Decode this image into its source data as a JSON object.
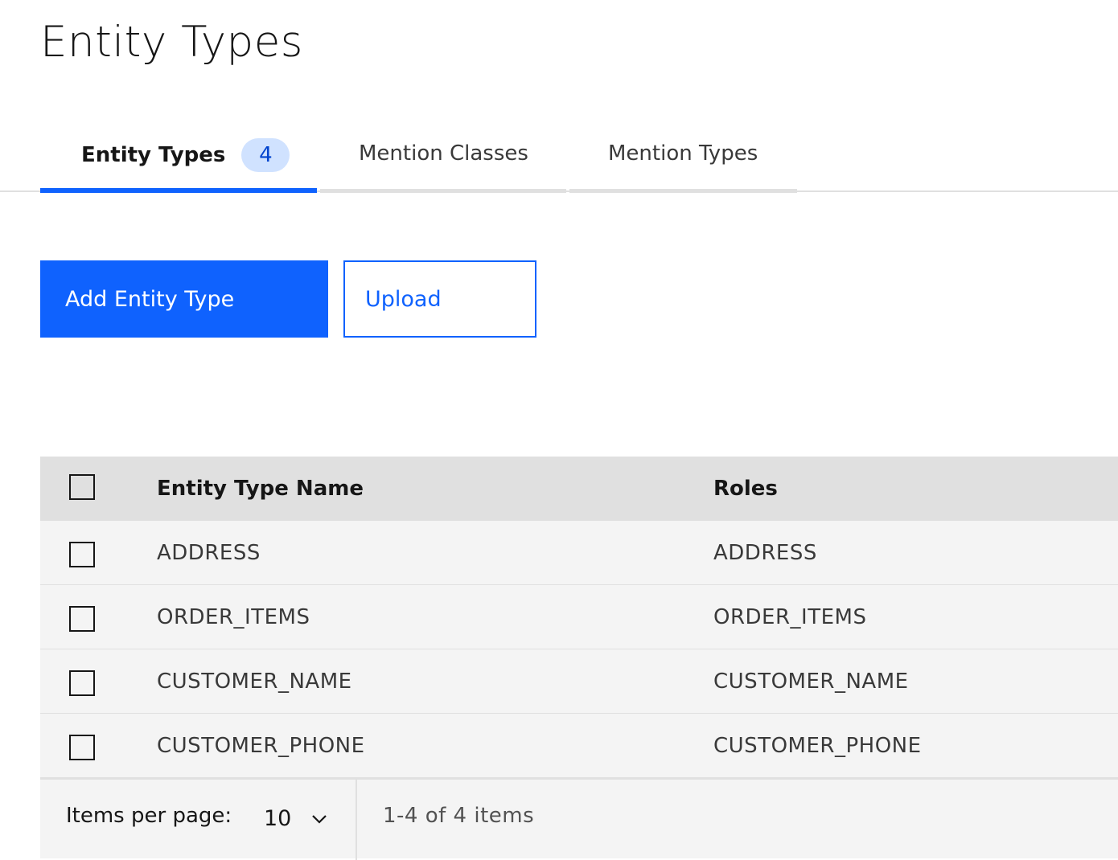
{
  "page": {
    "title": "Entity Types"
  },
  "tabs": [
    {
      "label": "Entity Types",
      "badge": "4",
      "active": true
    },
    {
      "label": "Mention Classes",
      "active": false
    },
    {
      "label": "Mention Types",
      "active": false
    }
  ],
  "actions": {
    "add_label": "Add Entity Type",
    "upload_label": "Upload"
  },
  "table": {
    "columns": [
      "Entity Type Name",
      "Roles"
    ],
    "rows": [
      {
        "name": "ADDRESS",
        "roles": "ADDRESS"
      },
      {
        "name": "ORDER_ITEMS",
        "roles": "ORDER_ITEMS"
      },
      {
        "name": "CUSTOMER_NAME",
        "roles": "CUSTOMER_NAME"
      },
      {
        "name": "CUSTOMER_PHONE",
        "roles": "CUSTOMER_PHONE"
      }
    ]
  },
  "pagination": {
    "items_per_page_label": "Items per page:",
    "items_per_page_value": "10",
    "range_text": "1-4 of 4 items",
    "chevron_icon": "chevron-down-icon"
  },
  "colors": {
    "primary": "#0f62fe",
    "badge_bg": "#d0e2ff",
    "badge_text": "#0043ce",
    "table_bg": "#f4f4f4",
    "header_bg": "#e0e0e0"
  }
}
